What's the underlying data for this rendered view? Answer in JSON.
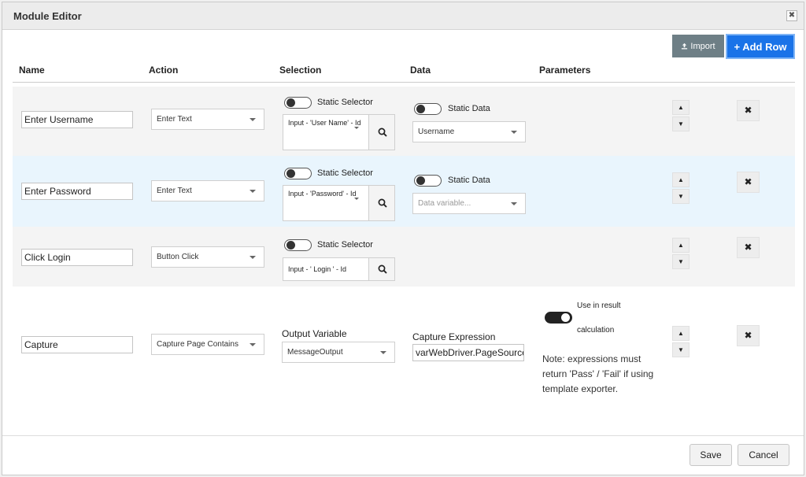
{
  "dialog": {
    "title": "Module Editor",
    "close_glyph": "✖"
  },
  "toolbar": {
    "import_label": "Import",
    "import_icon": "upload-icon",
    "add_row_label": "+ Add Row"
  },
  "columns": [
    "Name",
    "Action",
    "Selection",
    "Data",
    "Parameters"
  ],
  "rows": [
    {
      "name": "Enter Username",
      "action": "Enter Text",
      "static_selector_label": "Static Selector",
      "selector_value": "Input - 'User Name' - Id",
      "static_data_label": "Static Data",
      "data_value": "Username"
    },
    {
      "name": "Enter Password",
      "action": "Enter Text",
      "static_selector_label": "Static Selector",
      "selector_value": "Input - 'Password' - Id",
      "static_data_label": "Static Data",
      "data_placeholder": "Data variable..."
    },
    {
      "name": "Click Login",
      "action": "Button Click",
      "static_selector_label": "Static Selector",
      "selector_value": "Input - ' Login ' - Id"
    },
    {
      "name": "Capture",
      "action": "Capture Page Contains",
      "output_variable_label": "Output Variable",
      "output_variable_value": "MessageOutput",
      "capture_expression_label": "Capture Expression",
      "capture_expression_value": "varWebDriver.PageSource",
      "use_in_result_label_1": "Use in result",
      "use_in_result_label_2": "calculation",
      "use_in_result_on": true,
      "note": "Note: expressions must return 'Pass' / 'Fail' if using template exporter."
    }
  ],
  "row_controls": {
    "up_glyph": "▲",
    "down_glyph": "▼",
    "delete_glyph": "✖"
  },
  "footer": {
    "save_label": "Save",
    "cancel_label": "Cancel"
  }
}
